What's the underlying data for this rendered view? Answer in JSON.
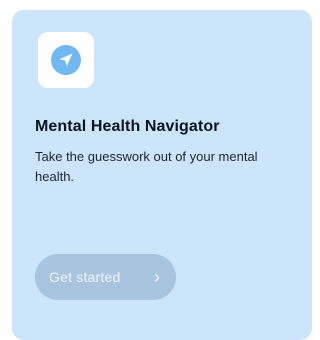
{
  "card": {
    "icon": "navigation-arrow-icon",
    "title": "Mental Health Navigator",
    "description": "Take the guesswork out of your mental health.",
    "cta_label": "Get started",
    "cta_icon": "chevron-right-icon"
  },
  "colors": {
    "card_background": "#cce5fb",
    "icon_accent": "#6fb8f3",
    "button_background": "#a8c4de",
    "button_text": "#eef5fc",
    "title_text": "#0b1520"
  }
}
